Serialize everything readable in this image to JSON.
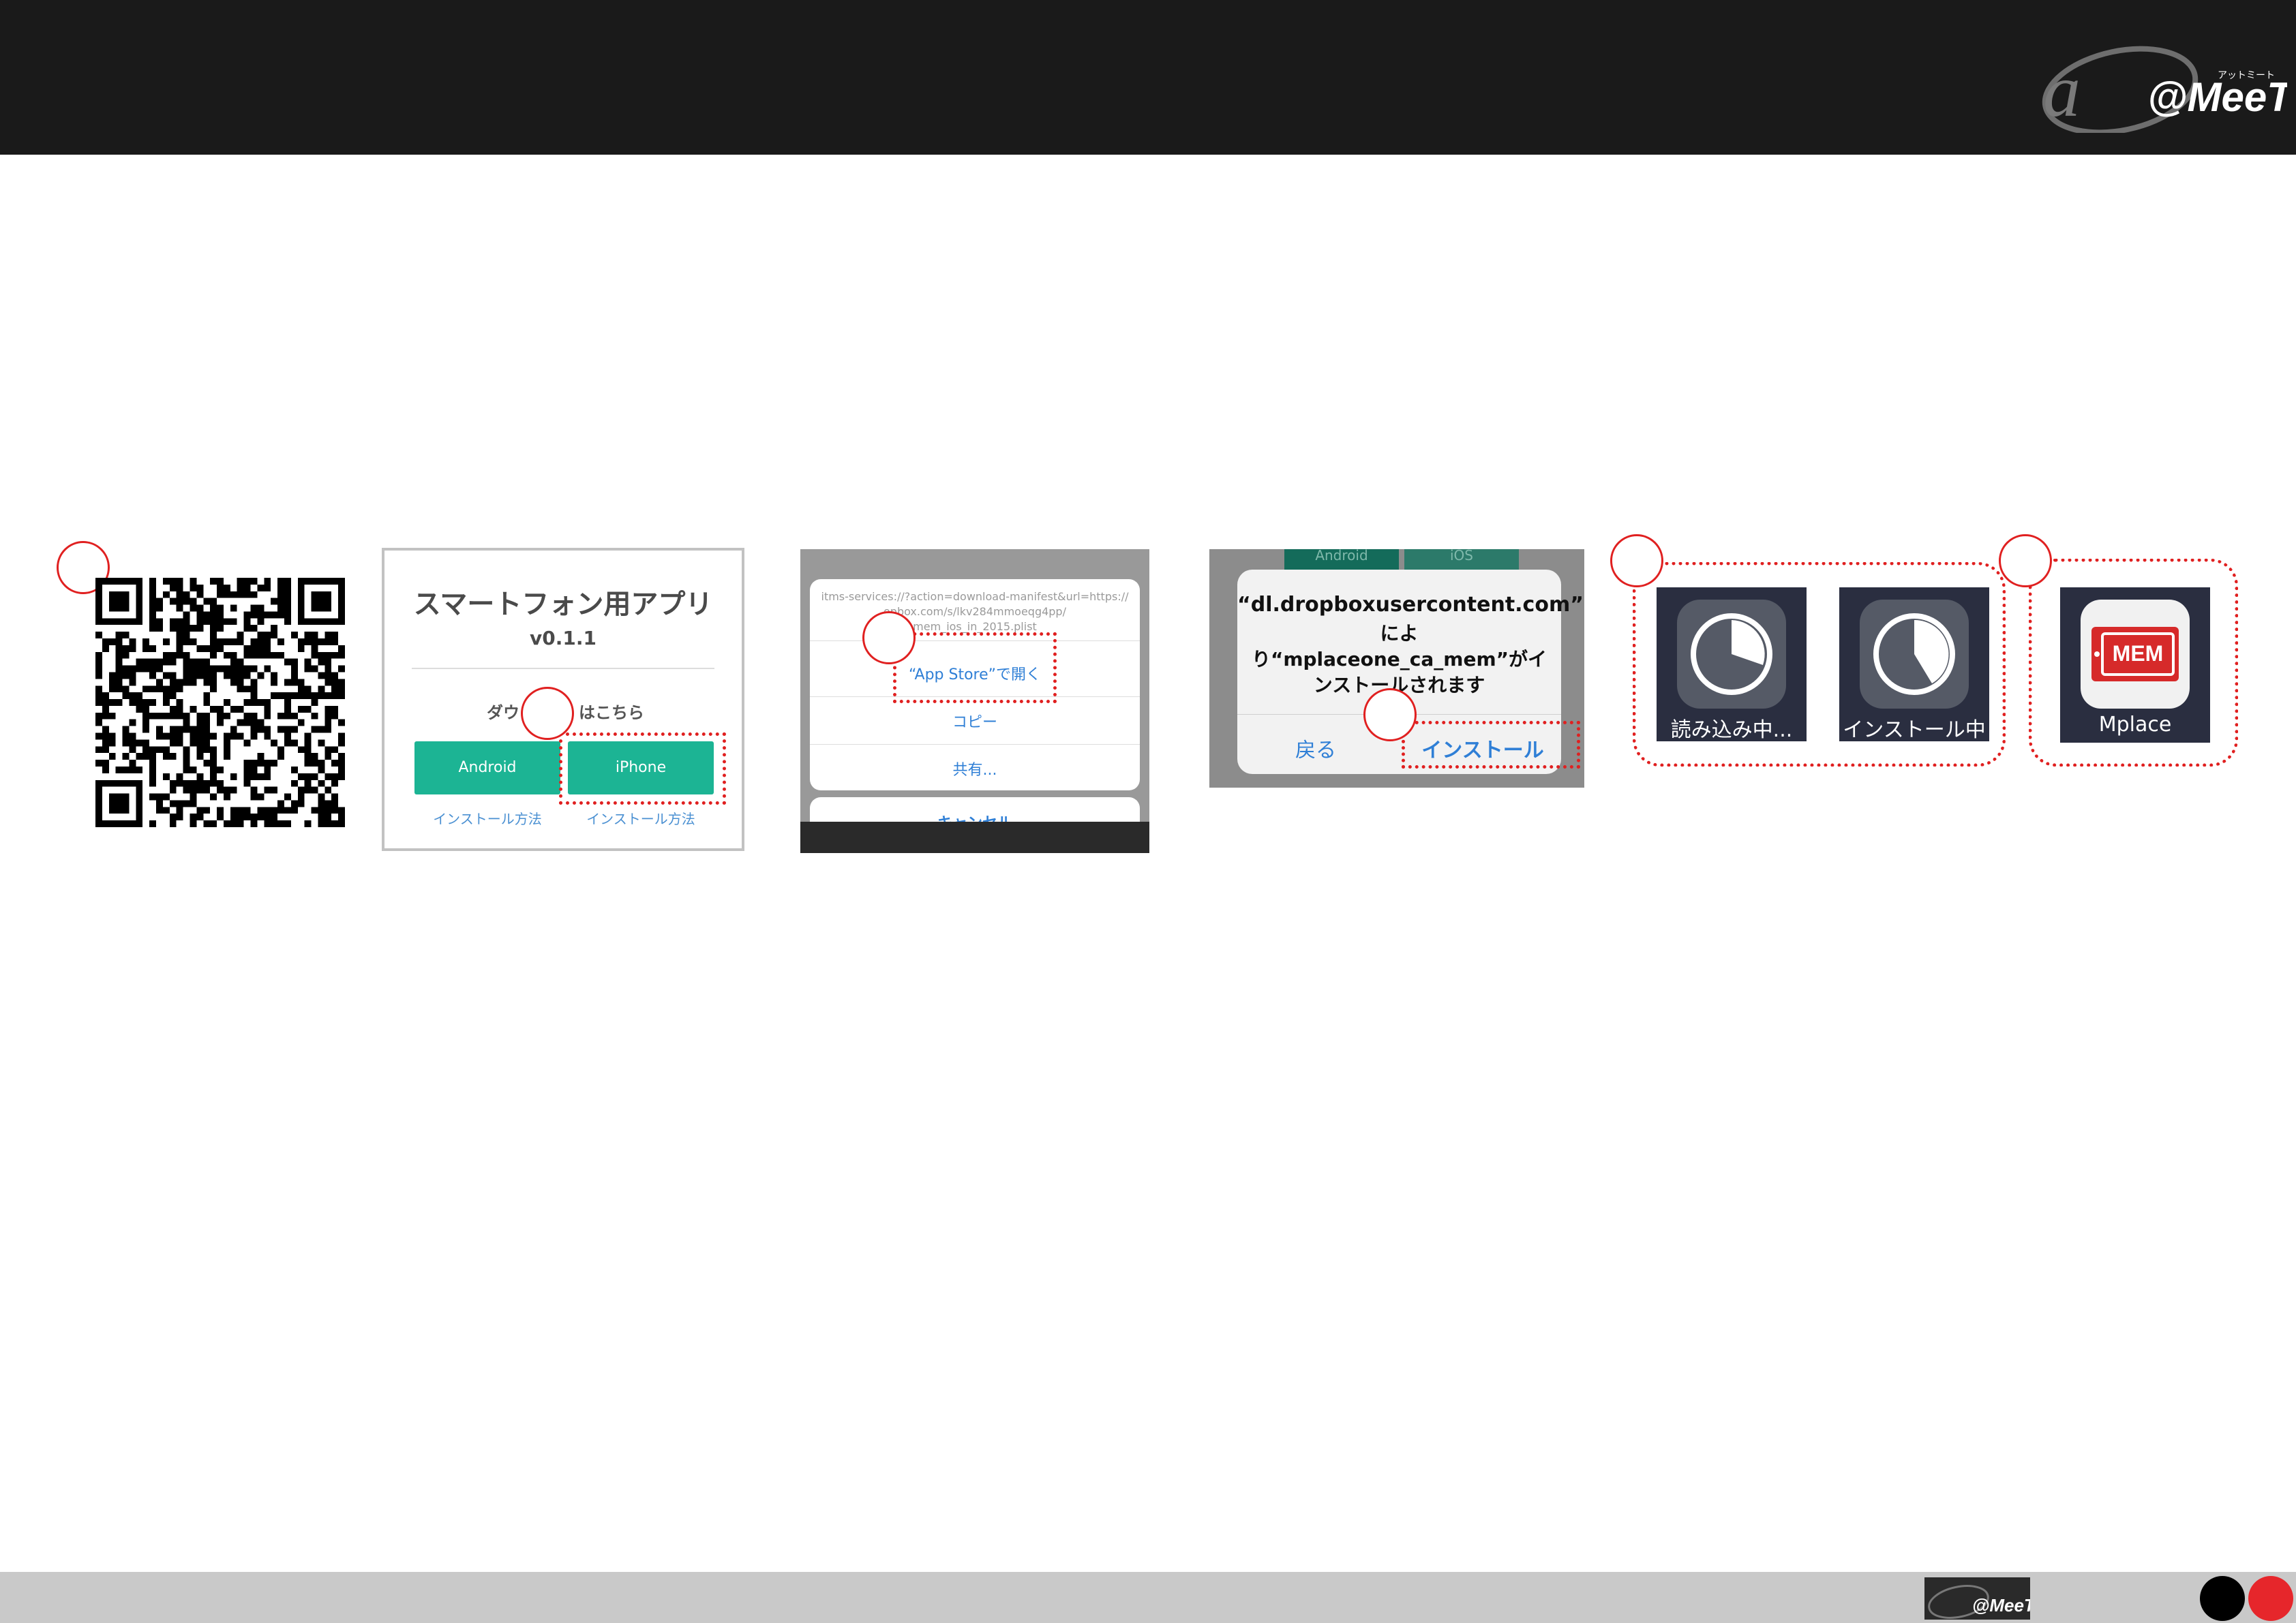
{
  "brand": {
    "name": "@MeeT",
    "tagline": "アットミート"
  },
  "step1": {
    "qr_caption": ""
  },
  "step2": {
    "title": "スマートフォン用アプリ",
    "version": "v0.1.1",
    "download_text_a": "ダウン",
    "download_text_b": "はこちら",
    "android_button": "Android",
    "iphone_button": "iPhone",
    "install_link_android": "インストール方法",
    "install_link_iphone": "インストール方法"
  },
  "step3": {
    "url_line1": "itms-services://?action=download-manifest&url=https://",
    "url_line2": "opbox.com/s/lkv284mmoeqg4pp/",
    "url_line3": "mem_ios_in_2015.plist",
    "open_app_store": "“App Store”で開く",
    "copy": "コピー",
    "share": "共有...",
    "cancel": "キャンセル"
  },
  "step4": {
    "bg_button_left": "Android",
    "bg_button_right": "iOS",
    "alert_line1": "“dl.dropboxusercontent.com”",
    "alert_line2": "によ",
    "alert_line3": "り“mplaceone_ca_mem”がイ",
    "alert_line4": "ンストールされます",
    "back": "戻る",
    "install": "インストール"
  },
  "step5": {
    "loading_label": "読み込み中...",
    "installing_label": "インストール中"
  },
  "step6": {
    "app_icon_text": "MEM",
    "app_label": "Mplace"
  },
  "colors": {
    "accent_red": "#e02020",
    "green": "#1cb494",
    "ios_blue": "#2f7fd6"
  }
}
